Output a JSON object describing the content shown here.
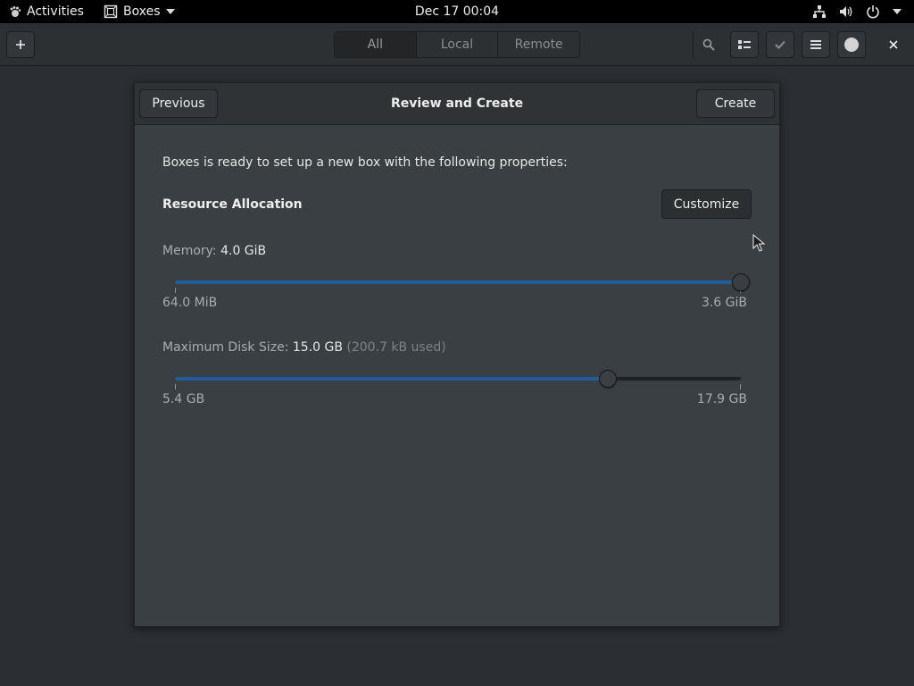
{
  "topbar": {
    "activities_label": "Activities",
    "app_menu_label": "Boxes",
    "clock": "Dec 17  00:04",
    "icons": [
      "network-icon",
      "volume-icon",
      "power-icon",
      "chevron-down-icon"
    ]
  },
  "header": {
    "new_icon": "plus-icon",
    "view_tabs": [
      {
        "label": "All",
        "active": true
      },
      {
        "label": "Local",
        "active": false
      },
      {
        "label": "Remote",
        "active": false
      }
    ],
    "icons": [
      "search-icon",
      "list-view-icon",
      "select-check-icon",
      "hamburger-menu-icon",
      "avatar-icon",
      "close-icon"
    ]
  },
  "dialog": {
    "title": "Review and Create",
    "previous_label": "Previous",
    "create_label": "Create",
    "intro": "Boxes is ready to set up a new box with the following properties:",
    "resource_heading": "Resource Allocation",
    "customize_label": "Customize",
    "memory": {
      "key": "Memory:",
      "value": "4.0 GiB",
      "min_label": "64.0 MiB",
      "max_label": "3.6 GiB",
      "level": 1.0
    },
    "disk": {
      "key": "Maximum Disk Size:",
      "value": "15.0 GB",
      "used": "(200.7 kB used)",
      "min_label": "5.4 GB",
      "max_label": "17.9 GB",
      "level": 0.765
    }
  },
  "colors": {
    "accent": "#215d9c",
    "dialog_bg": "#393f42",
    "window_bg": "#2b2e32"
  }
}
